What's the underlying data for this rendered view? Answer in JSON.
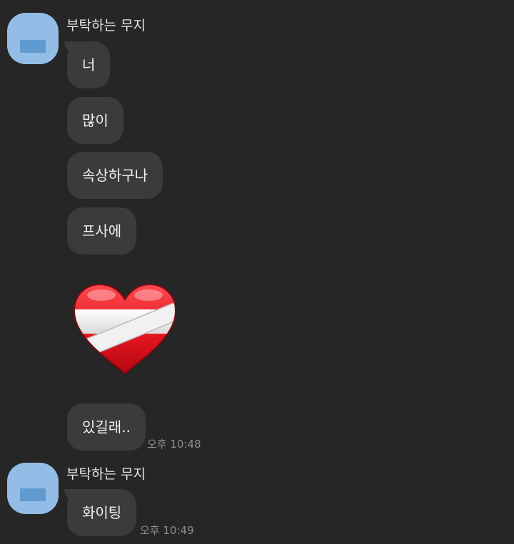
{
  "chat": {
    "groups": [
      {
        "sender": "부탁하는 무지",
        "messages": [
          "너",
          "많이",
          "속상하구나",
          "프사에"
        ],
        "sticker": "bandaged-heart-icon",
        "last_message": "있길래..",
        "time": "오후 10:48"
      },
      {
        "sender": "부탁하는 무지",
        "messages": [
          "화이팅"
        ],
        "time": "오후 10:49"
      }
    ]
  },
  "colors": {
    "background": "#262626",
    "bubble": "#3b3b3b",
    "avatar": "#93bde6",
    "text": "#f2f2f2",
    "time": "#8e8e8e",
    "heart_red": "#e0141e"
  }
}
